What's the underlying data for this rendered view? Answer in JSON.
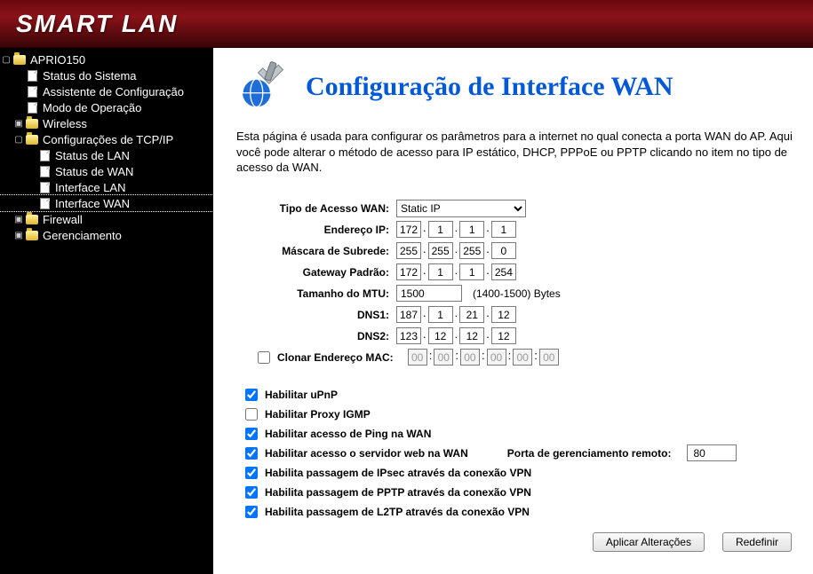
{
  "brand": "SMART LAN",
  "tree": {
    "root": "APRIO150",
    "status": "Status do Sistema",
    "assist": "Assistente de Configuração",
    "mode": "Modo de Operação",
    "wireless": "Wireless",
    "tcpip": "Configurações de TCP/IP",
    "lan_status": "Status de LAN",
    "wan_status": "Status de WAN",
    "if_lan": "Interface LAN",
    "if_wan": "Interface WAN",
    "firewall": "Firewall",
    "mgmt": "Gerenciamento"
  },
  "page": {
    "title": "Configuração de Interface WAN",
    "desc": "Esta página é usada para configurar os parâmetros para a internet no qual conecta a porta WAN do AP. Aqui você pode alterar o método de acesso para IP estático, DHCP, PPPoE ou PPTP clicando no item no tipo de acesso da WAN."
  },
  "labels": {
    "wan_type": "Tipo de Acesso WAN:",
    "ip": "Endereço IP:",
    "mask": "Máscara de Subrede:",
    "gw": "Gateway Padrão:",
    "mtu": "Tamanho do MTU:",
    "dns1": "DNS1:",
    "dns2": "DNS2:",
    "clone": "Clonar Endereço MAC:",
    "mtu_hint": "(1400-1500) Bytes",
    "port": "Porta de gerenciamento remoto:"
  },
  "values": {
    "wan_type": "Static IP",
    "ip": [
      "172",
      "1",
      "1",
      "1"
    ],
    "mask": [
      "255",
      "255",
      "255",
      "0"
    ],
    "gw": [
      "172",
      "1",
      "1",
      "254"
    ],
    "mtu": "1500",
    "dns1": [
      "187",
      "1",
      "21",
      "12"
    ],
    "dns2": [
      "123",
      "12",
      "12",
      "12"
    ],
    "mac": [
      "00",
      "00",
      "00",
      "00",
      "00",
      "00"
    ],
    "port": "80"
  },
  "checks": {
    "upnp": {
      "label": "Habilitar uPnP",
      "checked": true
    },
    "igmp": {
      "label": "Habilitar Proxy IGMP",
      "checked": false
    },
    "ping": {
      "label": "Habilitar acesso de Ping na WAN",
      "checked": true
    },
    "web": {
      "label": "Habilitar acesso o servidor web na WAN",
      "checked": true
    },
    "ipsec": {
      "label": "Habilita passagem de IPsec através da conexão VPN",
      "checked": true
    },
    "pptp": {
      "label": "Habilita passagem de PPTP através da conexão VPN",
      "checked": true
    },
    "l2tp": {
      "label": "Habilita passagem de L2TP através da conexão VPN",
      "checked": true
    }
  },
  "buttons": {
    "apply": "Aplicar Alterações",
    "reset": "Redefinir"
  }
}
